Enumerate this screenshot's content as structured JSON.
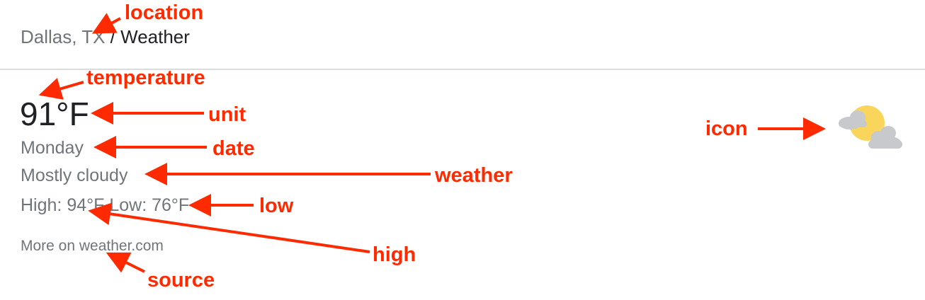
{
  "breadcrumb": {
    "location": "Dallas, TX",
    "separator": " / ",
    "current": "Weather"
  },
  "weather": {
    "temperature": "91",
    "unit": "°F",
    "day": "Monday",
    "condition": "Mostly cloudy",
    "high_label": "High: ",
    "high_value": "94°F",
    "low_label": " Low: ",
    "low_value": "76°F",
    "icon": "partly-cloudy-icon"
  },
  "source": {
    "label": "More on weather.com"
  },
  "annotations": {
    "location": "location",
    "temperature": "temperature",
    "unit": "unit",
    "date": "date",
    "weather": "weather",
    "low": "low",
    "high": "high",
    "source": "source",
    "icon": "icon"
  },
  "colors": {
    "annotation": "#ff2a00",
    "secondary_text": "#70757a",
    "primary_text": "#202124",
    "divider": "#dadce0",
    "sun": "#f9d65b",
    "cloud": "#c8c9cc"
  }
}
